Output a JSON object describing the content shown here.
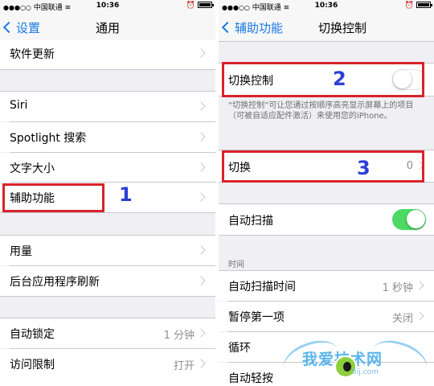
{
  "left": {
    "status": {
      "carrier": "中国联通",
      "time": "10:36"
    },
    "nav": {
      "back": "设置",
      "title": "通用"
    },
    "rows": {
      "software_update": "软件更新",
      "siri": "Siri",
      "spotlight": "Spotlight 搜索",
      "text_size": "文字大小",
      "accessibility": "辅助功能",
      "usage": "用量",
      "background_refresh": "后台应用程序刷新",
      "auto_lock": {
        "label": "自动锁定",
        "value": "1 分钟"
      },
      "restrictions": {
        "label": "访问限制",
        "value": "打开"
      }
    },
    "badge": "1"
  },
  "right": {
    "status": {
      "carrier": "中国联通",
      "time": "10:36"
    },
    "nav": {
      "back": "辅助功能",
      "title": "切换控制"
    },
    "switch_control": {
      "label": "切换控制",
      "on": false
    },
    "note": "“切换控制”可让您通过按顺序高亮显示屏幕上的项目（可被自适应配件激活）来使用您的iPhone。",
    "switches": {
      "label": "切换",
      "value": "0"
    },
    "auto_scan": {
      "label": "自动扫描",
      "on": true
    },
    "timing_header": "时间",
    "auto_scan_time": {
      "label": "自动扫描时间",
      "value": "1 秒钟"
    },
    "pause_first": {
      "label": "暂停第一项",
      "value": "关闭"
    },
    "loop": {
      "label": "循环"
    },
    "auto_tap": {
      "label": "自动轻按"
    },
    "badge2": "2",
    "badge3": "3"
  },
  "watermark": {
    "text": "我爱技术网",
    "url": "5ij.com"
  },
  "colors": {
    "accent": "#1a7ae6",
    "toggle_on": "#4cd964",
    "annotation_box": "#d9232a",
    "annotation_number": "#2b3fd6"
  }
}
